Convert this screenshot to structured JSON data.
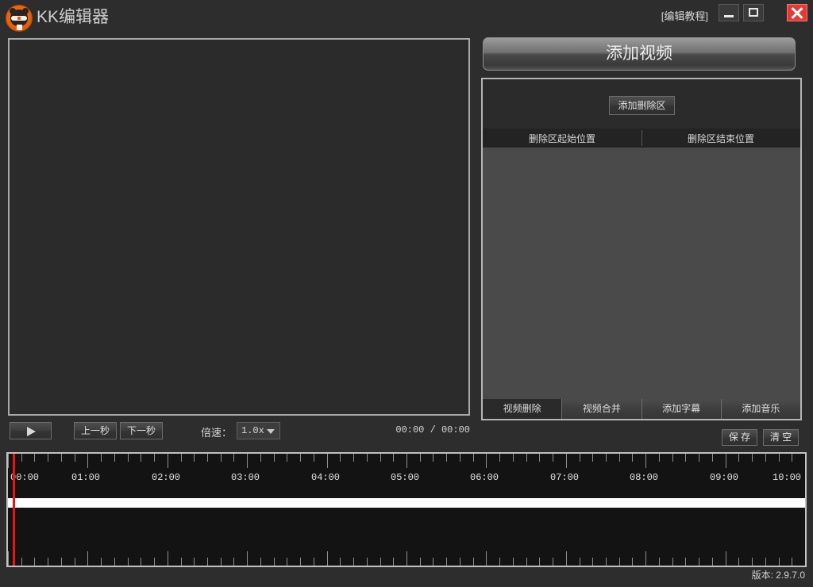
{
  "window": {
    "app_title": "KK编辑器",
    "logo_icon": "cat-logo-icon",
    "tutorial_link": "[编辑教程]",
    "minimize_icon": "minimize-icon",
    "maximize_icon": "maximize-icon",
    "close_icon": "close-icon",
    "version": "版本: 2.9.7.0"
  },
  "player": {
    "play_icon": "play-icon",
    "prev_second": "上一秒",
    "next_second": "下一秒",
    "speed_label": "倍速：",
    "speed_value": "1.0x",
    "speed_options": [
      "1.0x"
    ],
    "caret_icon": "chevron-down-icon",
    "current_time": "00:00",
    "total_time": "00:00",
    "time_display": "00:00  /  00:00"
  },
  "right": {
    "add_video": "添加视频",
    "add_delete_zone": "添加删除区",
    "table": {
      "columns": [
        "删除区起始位置",
        "删除区结束位置"
      ],
      "rows": []
    },
    "tabs": [
      {
        "label": "视频删除",
        "active": true
      },
      {
        "label": "视频合并",
        "active": false
      },
      {
        "label": "添加字幕",
        "active": false
      },
      {
        "label": "添加音乐",
        "active": false
      }
    ],
    "save": "保 存",
    "clear": "清 空"
  },
  "timeline": {
    "start": "00:00",
    "end": "10:00",
    "playhead_time": "00:00",
    "major_labels": [
      "00:00",
      "01:00",
      "02:00",
      "03:00",
      "04:00",
      "05:00",
      "06:00",
      "07:00",
      "08:00",
      "09:00",
      "10:00"
    ],
    "minor_tick_seconds": 10,
    "major_tick_seconds": 60,
    "total_seconds": 600
  },
  "colors": {
    "window_bg": "#2d2d2d",
    "panel_border": "#b5b5b5",
    "list_bg": "#4a4a4a",
    "timeline_bg": "#131313",
    "playhead": "#ee1111",
    "track": "#ffffff",
    "close_red": "#e23b36",
    "logo_orange": "#e2600f"
  }
}
